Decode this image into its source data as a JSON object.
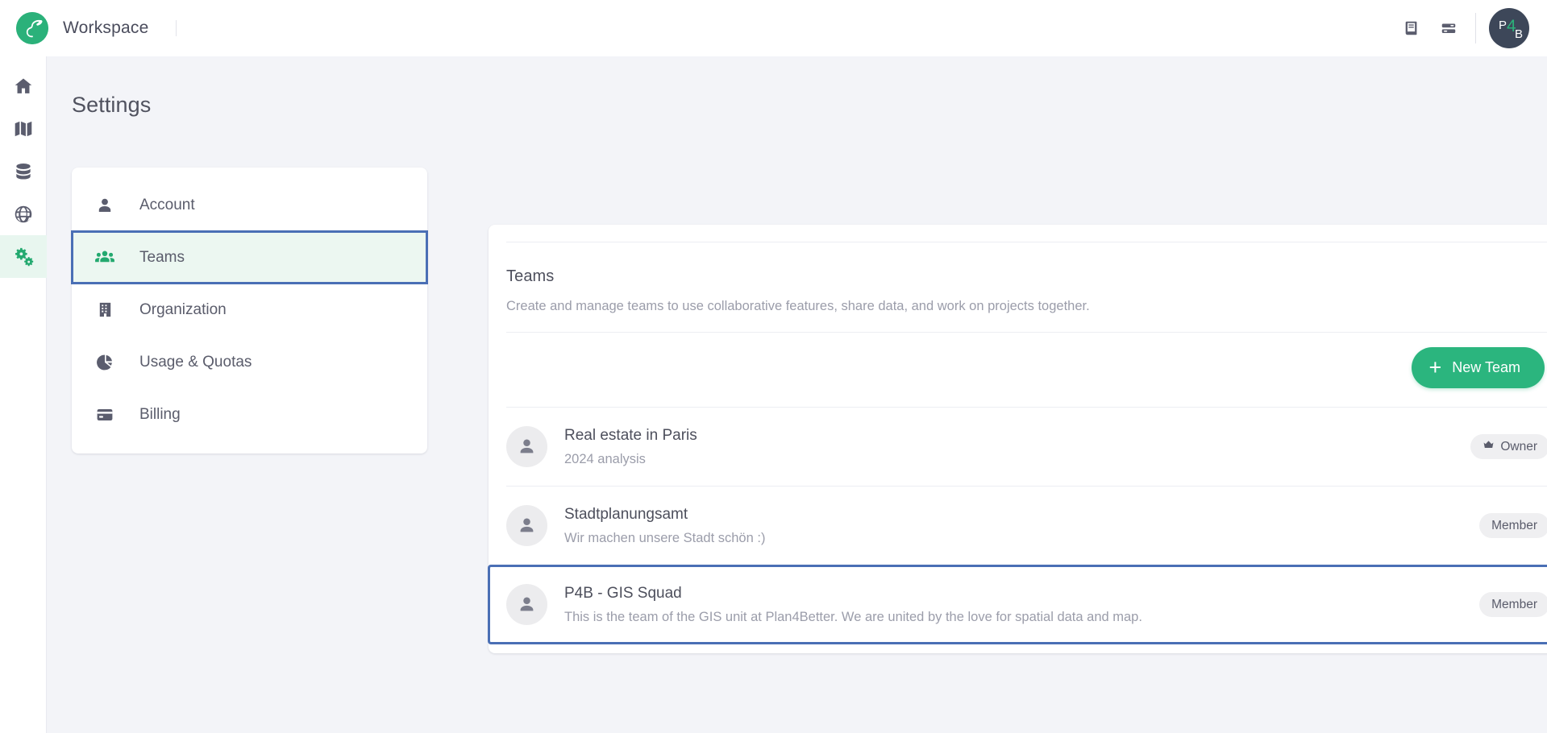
{
  "topbar": {
    "brand_title": "Workspace",
    "logo_icon": "goat-logo-icon",
    "docs_icon": "book-icon",
    "layout_icon": "list-panel-icon",
    "avatar": {
      "p": "P",
      "four": "4",
      "b": "B"
    }
  },
  "rail": {
    "items": [
      {
        "icon": "home-icon",
        "name": "home",
        "active": false
      },
      {
        "icon": "map-icon",
        "name": "map",
        "active": false
      },
      {
        "icon": "database-icon",
        "name": "data",
        "active": false
      },
      {
        "icon": "globe-icon",
        "name": "catalog",
        "active": false
      },
      {
        "icon": "settings-gears-icon",
        "name": "settings",
        "active": true
      }
    ]
  },
  "page": {
    "title": "Settings"
  },
  "settings_menu": {
    "items": [
      {
        "label": "Account",
        "icon": "person-icon",
        "selected": false
      },
      {
        "label": "Teams",
        "icon": "people-group-icon",
        "selected": true
      },
      {
        "label": "Organization",
        "icon": "building-icon",
        "selected": false
      },
      {
        "label": "Usage & Quotas",
        "icon": "pie-chart-icon",
        "selected": false
      },
      {
        "label": "Billing",
        "icon": "credit-card-icon",
        "selected": false
      }
    ]
  },
  "teams_panel": {
    "heading": "Teams",
    "description": "Create and manage teams to use collaborative features, share data, and work on projects together.",
    "new_team_label": "New Team",
    "new_team_plus": "+",
    "teams": [
      {
        "name": "Real estate in Paris",
        "description": "2024 analysis",
        "role": "Owner",
        "role_icon": "crown-icon",
        "highlighted": false
      },
      {
        "name": "Stadtplanungsamt",
        "description": "Wir machen unsere Stadt schön :)",
        "role": "Member",
        "role_icon": "",
        "highlighted": false
      },
      {
        "name": "P4B - GIS Squad",
        "description": "This is the team of the GIS unit at Plan4Better. We are united by the love for spatial data and map.",
        "role": "Member",
        "role_icon": "",
        "highlighted": true
      }
    ]
  },
  "colors": {
    "accent_green": "#2bb57e",
    "highlight_blue": "#4a6fb5",
    "page_bg": "#f3f4f8",
    "avatar_bg": "#3d4759"
  }
}
